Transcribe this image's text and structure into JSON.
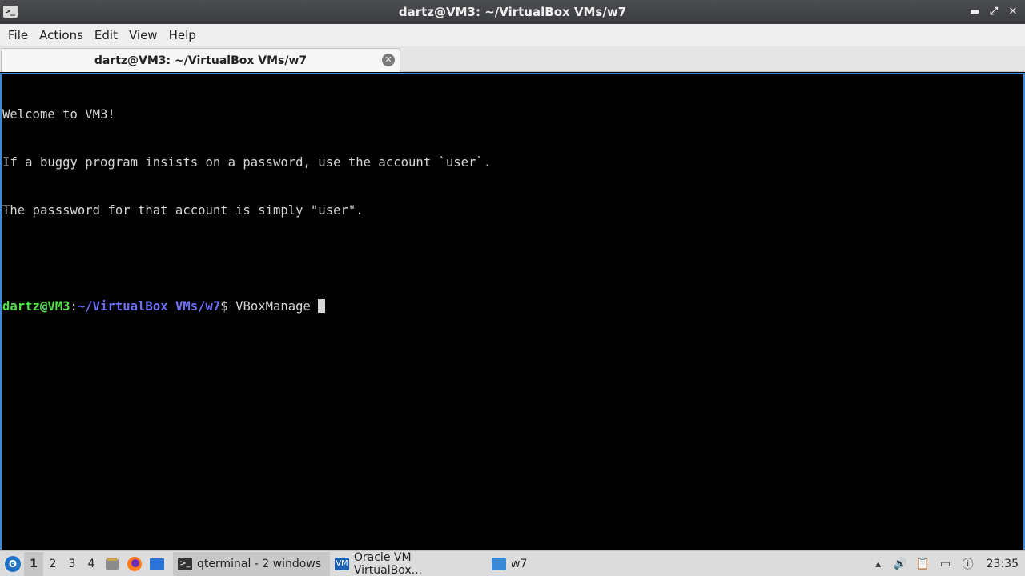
{
  "window": {
    "title": "dartz@VM3: ~/VirtualBox VMs/w7",
    "controls": {
      "minimize": "▬",
      "maximize": "⤢",
      "close": "✕"
    }
  },
  "menu": {
    "items": [
      "File",
      "Actions",
      "Edit",
      "View",
      "Help"
    ]
  },
  "tabs": [
    {
      "label": "dartz@VM3: ~/VirtualBox VMs/w7",
      "active": true
    }
  ],
  "terminal": {
    "lines": [
      "Welcome to VM3!",
      "If a buggy program insists on a password, use the account `user`.",
      "The passsword for that account is simply \"user\".",
      ""
    ],
    "prompt": {
      "user_host": "dartz@VM3",
      "sep": ":",
      "path": "~/VirtualBox VMs/w7",
      "symbol": "$ ",
      "command": "VBoxManage "
    },
    "colors": {
      "user": "#53e048",
      "path": "#6e6ef7",
      "text": "#d6d6d6",
      "focus_border": "#3a8be0"
    }
  },
  "taskbar": {
    "workspaces": [
      "1",
      "2",
      "3",
      "4"
    ],
    "active_workspace": "1",
    "tasks": [
      {
        "label": "qterminal - 2 windows",
        "icon": "terminal-icon",
        "active": true
      },
      {
        "label": "Oracle VM VirtualBox...",
        "icon": "virtualbox-icon",
        "active": false
      },
      {
        "label": "w7",
        "icon": "folder-icon",
        "active": false
      }
    ],
    "clock": "23:35"
  }
}
